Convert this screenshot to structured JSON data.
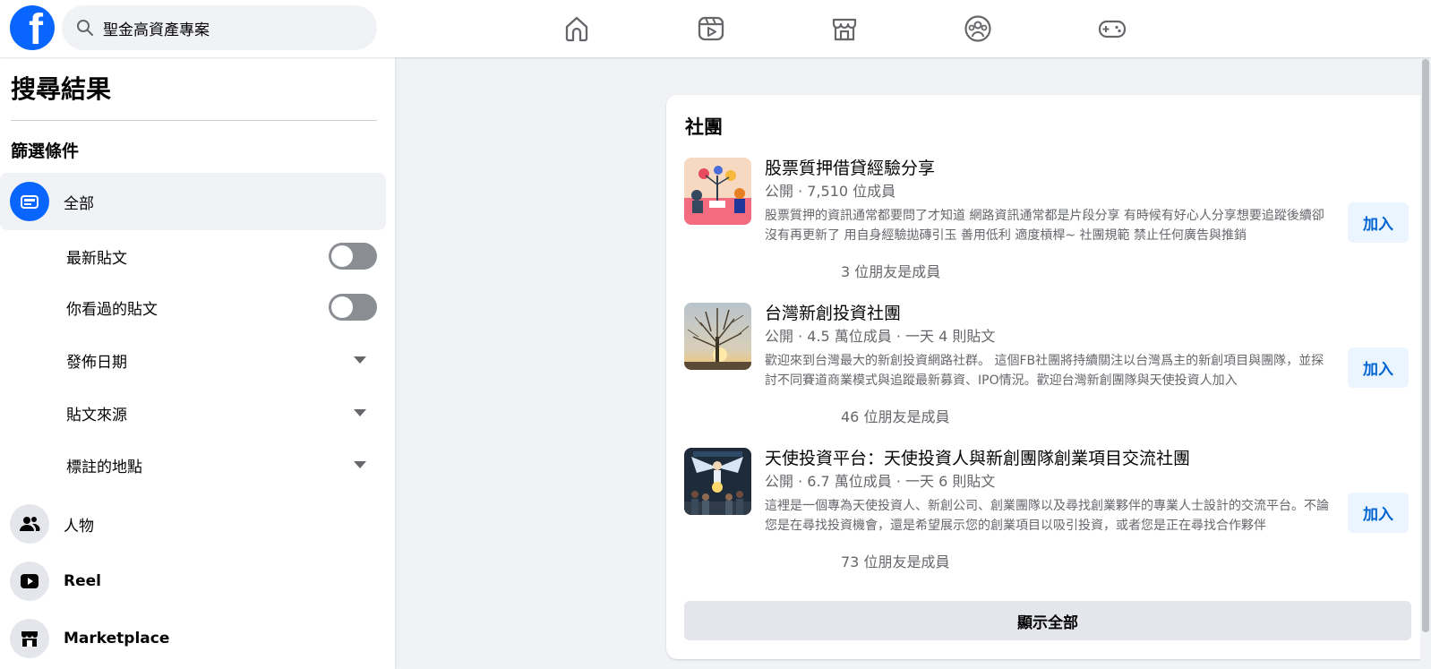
{
  "search": {
    "query": "聖金高資產專案"
  },
  "nav": [
    {
      "icon": "home-icon"
    },
    {
      "icon": "video-icon"
    },
    {
      "icon": "marketplace-icon"
    },
    {
      "icon": "groups-icon"
    },
    {
      "icon": "gaming-icon"
    }
  ],
  "sidebar": {
    "title": "搜尋結果",
    "filter_heading": "篩選條件",
    "all_label": "全部",
    "subfilters": [
      {
        "label": "最新貼文",
        "control": "toggle",
        "on": false
      },
      {
        "label": "你看過的貼文",
        "control": "toggle",
        "on": false
      },
      {
        "label": "發佈日期",
        "control": "dropdown"
      },
      {
        "label": "貼文來源",
        "control": "dropdown"
      },
      {
        "label": "標註的地點",
        "control": "dropdown"
      }
    ],
    "categories": [
      {
        "label": "人物",
        "icon": "people-icon"
      },
      {
        "label": "Reel",
        "icon": "reel-icon"
      },
      {
        "label": "Marketplace",
        "icon": "marketplace-icon"
      }
    ]
  },
  "groups_card": {
    "title": "社團",
    "groups": [
      {
        "name": "股票質押借貸經驗分享",
        "meta": "公開 · 7,510 位成員",
        "description": "股票質押的資訊通常都要問了才知道 網路資訊通常都是片段分享 有時候有好心人分享想要追蹤後續卻沒有再更新了 用自身經驗拋磚引玉 善用低利 適度槓桿~ 社團規範 禁止任何廣告與推銷",
        "friends": "3 位朋友是成員",
        "join_label": "加入"
      },
      {
        "name": "台灣新創投資社團",
        "meta": "公開 · 4.5 萬位成員 · 一天 4 則貼文",
        "description": "歡迎來到台灣最大的新創投資網路社群。 這個FB社團將持續關注以台灣爲主的新創項目與團隊，並探討不同賽道商業模式與追蹤最新募資、IPO情況。歡迎台灣新創團隊與天使投資人加入",
        "friends": "46 位朋友是成員",
        "join_label": "加入"
      },
      {
        "name": "天使投資平台：天使投資人與新創團隊創業項目交流社團",
        "meta": "公開 · 6.7 萬位成員 · 一天 6 則貼文",
        "description": "這裡是一個專為天使投資人、新創公司、創業團隊以及尋找創業夥伴的專業人士設計的交流平台。不論您是在尋找投資機會，還是希望展示您的創業項目以吸引投資，或者您是正在尋找合作夥伴",
        "friends": "73 位朋友是成員",
        "join_label": "加入"
      }
    ],
    "show_all_label": "顯示全部"
  }
}
